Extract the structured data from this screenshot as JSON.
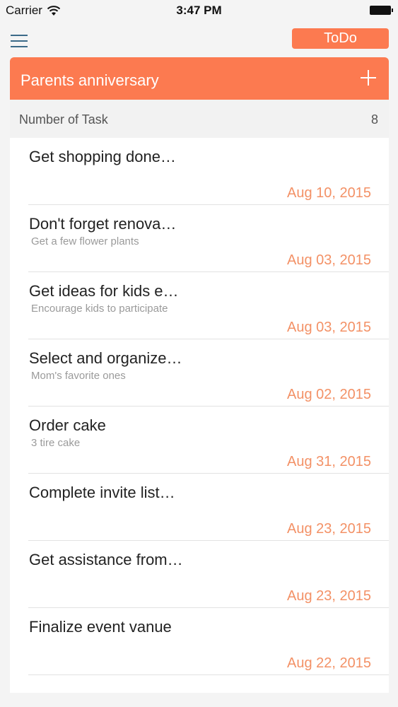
{
  "status_bar": {
    "carrier": "Carrier",
    "time": "3:47 PM"
  },
  "header": {
    "todo_label": "ToDo"
  },
  "list": {
    "title": "Parents anniversary",
    "count_label": "Number of Task",
    "count_value": "8"
  },
  "accent_color": "#fc7a50",
  "tasks": [
    {
      "title": "Get shopping done…",
      "note": "",
      "date": "Aug 10, 2015"
    },
    {
      "title": "Don't forget renova…",
      "note": "Get a few flower plants",
      "date": "Aug 03, 2015"
    },
    {
      "title": "Get ideas for kids e…",
      "note": "Encourage kids to participate",
      "date": "Aug 03, 2015"
    },
    {
      "title": "Select and organize…",
      "note": "Mom's favorite ones",
      "date": "Aug 02, 2015"
    },
    {
      "title": "Order cake",
      "note": "3 tire cake",
      "date": "Aug 31, 2015"
    },
    {
      "title": "Complete invite list…",
      "note": "",
      "date": "Aug 23, 2015"
    },
    {
      "title": "Get assistance from…",
      "note": "",
      "date": "Aug 23, 2015"
    },
    {
      "title": "Finalize event vanue",
      "note": "",
      "date": "Aug 22, 2015"
    }
  ]
}
